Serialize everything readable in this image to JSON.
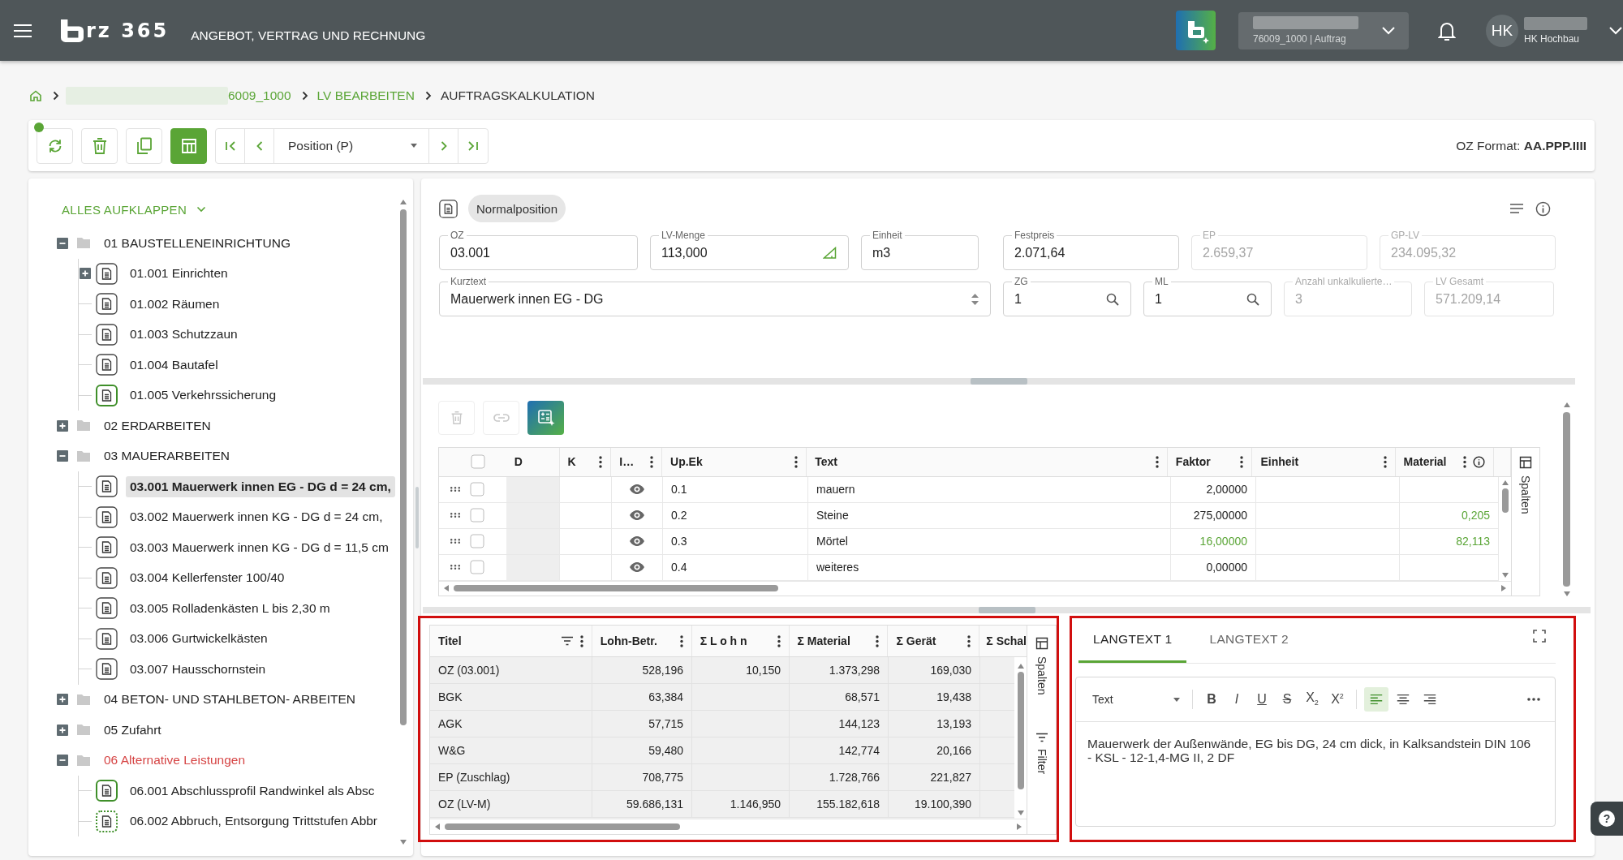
{
  "header": {
    "logo": "rz 365",
    "app_title": "ANGEBOT, VERTRAG UND RECHNUNG",
    "project": {
      "subtitle": "76009_1000 | Auftrag"
    },
    "user": {
      "initials": "HK",
      "company": "HK Hochbau"
    }
  },
  "breadcrumb": [
    {
      "label": "6009_1000",
      "link": true
    },
    {
      "label": "LV BEARBEITEN",
      "link": true
    },
    {
      "label": "AUFTRAGSKALKULATION",
      "link": false
    }
  ],
  "toolbar": {
    "sync_dot": true,
    "buttons": [
      {
        "kind": "refresh",
        "active": false
      },
      {
        "kind": "delete",
        "active": false
      },
      {
        "kind": "copy",
        "active": false
      },
      {
        "kind": "layout",
        "active": true
      }
    ],
    "position_select": "Position (P)",
    "oz_format": "OZ Format: **AA.PPP.IIII**"
  },
  "tree": {
    "expand_all": "ALLES AUFKLAPPEN",
    "items": [
      {
        "label": "01 BAUSTELLENEINRICHTUNG",
        "expanded": true,
        "invalid": false,
        "selected": false,
        "children": [
          {
            "label": "01.001 Einrichten",
            "expanded": false,
            "marked": false,
            "dotted": false,
            "selected": false
          },
          {
            "label": "01.002 Räumen",
            "marked": false,
            "dotted": false,
            "selected": false
          },
          {
            "label": "01.003 Schutzzaun",
            "marked": false,
            "dotted": false,
            "selected": false
          },
          {
            "label": "01.004 Bautafel",
            "marked": false,
            "dotted": false,
            "selected": false
          },
          {
            "label": "01.005 Verkehrssicherung",
            "marked": true,
            "dotted": false,
            "selected": false
          }
        ]
      },
      {
        "label": "02 ERDARBEITEN",
        "expanded": false,
        "invalid": false,
        "selected": false
      },
      {
        "label": "03 MAUERARBEITEN",
        "expanded": true,
        "invalid": false,
        "selected": false,
        "children": [
          {
            "label": "03.001 Mauerwerk innen EG - DG d = 24 cm,",
            "marked": false,
            "dotted": false,
            "selected": true
          },
          {
            "label": "03.002 Mauerwerk innen KG - DG d = 24 cm,",
            "marked": false,
            "dotted": false,
            "selected": false
          },
          {
            "label": "03.003 Mauerwerk innen KG - DG d = 11,5 cm",
            "marked": false,
            "dotted": false,
            "selected": false
          },
          {
            "label": "03.004 Kellerfenster 100/40",
            "marked": false,
            "dotted": false,
            "selected": false
          },
          {
            "label": "03.005 Rolladenkästen L bis 2,30 m",
            "marked": false,
            "dotted": false,
            "selected": false
          },
          {
            "label": "03.006 Gurtwickelkästen",
            "marked": false,
            "dotted": false,
            "selected": false
          },
          {
            "label": "03.007 Hausschornstein",
            "marked": false,
            "dotted": false,
            "selected": false
          }
        ]
      },
      {
        "label": "04 BETON- UND STAHLBETON- ARBEITEN",
        "expanded": false,
        "invalid": false,
        "selected": false
      },
      {
        "label": "05 Zufahrt",
        "expanded": false,
        "invalid": false,
        "selected": false
      },
      {
        "label": "06 Alternative Leistungen",
        "expanded": true,
        "invalid": true,
        "selected": false,
        "children": [
          {
            "label": "06.001 Abschlussprofil Randwinkel als Absc",
            "marked": true,
            "dotted": false,
            "selected": false
          },
          {
            "label": "06.002 Abbruch, Entsorgung Trittstufen Abbr",
            "marked": true,
            "dotted": true,
            "selected": false
          }
        ]
      }
    ]
  },
  "position_form": {
    "type": "Normalposition",
    "rows": [
      {
        "fields": [
          {
            "label": "OZ",
            "value": "03.001",
            "kind": "text",
            "disabled": false
          },
          {
            "label": "LV-Menge",
            "value": "113,000",
            "kind": "quantity",
            "disabled": false
          },
          {
            "label": "Einheit",
            "value": "m3",
            "kind": "text",
            "disabled": false
          },
          {
            "label": "Festpreis",
            "value": "2.071,64",
            "kind": "text",
            "disabled": false
          },
          {
            "label": "EP",
            "value": "2.659,37",
            "kind": "text",
            "disabled": true
          },
          {
            "label": "GP-LV",
            "value": "234.095,32",
            "kind": "text",
            "disabled": true
          }
        ]
      },
      {
        "fields": [
          {
            "label": "Kurztext",
            "value": "Mauerwerk innen EG - DG",
            "kind": "select",
            "disabled": false
          },
          {
            "label": "ZG",
            "value": "1",
            "kind": "lookup",
            "disabled": false
          },
          {
            "label": "ML",
            "value": "1",
            "kind": "lookup",
            "disabled": false
          },
          {
            "label": "Anzahl unkalkulierte…",
            "value": "3",
            "kind": "text",
            "disabled": true
          },
          {
            "label": "LV Gesamt",
            "value": "571.209,14",
            "kind": "text",
            "disabled": true
          }
        ]
      }
    ]
  },
  "items_table": {
    "actions": [
      {
        "kind": "delete",
        "disabled": true
      },
      {
        "kind": "link",
        "disabled": true
      },
      {
        "kind": "assistant",
        "disabled": false
      }
    ],
    "all_checked": false,
    "columns": [
      {
        "label": "D",
        "menu": false,
        "info": false
      },
      {
        "label": "K",
        "menu": true,
        "info": false
      },
      {
        "label": "I…",
        "menu": true,
        "info": false
      },
      {
        "label": "Up.Ek",
        "menu": true,
        "info": false
      },
      {
        "label": "Text",
        "menu": true,
        "info": false
      },
      {
        "label": "Faktor",
        "menu": true,
        "info": false
      },
      {
        "label": "Einheit",
        "menu": true,
        "info": false
      },
      {
        "label": "Material",
        "menu": true,
        "info": true
      }
    ],
    "rows": [
      {
        "checked": false,
        "visible": true,
        "up_ek": "0.1",
        "text": "mauern",
        "faktor": "2,00000",
        "faktor_calculated": false
      },
      {
        "checked": false,
        "visible": true,
        "up_ek": "0.2",
        "text": "Steine",
        "faktor": "275,00000",
        "faktor_calculated": false,
        "material": "0,205"
      },
      {
        "checked": false,
        "visible": true,
        "up_ek": "0.3",
        "text": "Mörtel",
        "faktor": "16,00000",
        "faktor_calculated": true,
        "material": "82,113"
      },
      {
        "checked": false,
        "visible": true,
        "up_ek": "0.4",
        "text": "weiteres",
        "faktor": "0,00000",
        "faktor_calculated": false
      }
    ],
    "side_tab": "Spalten"
  },
  "summary_table": {
    "outlined": true,
    "columns": [
      {
        "label": "Titel",
        "filter": true,
        "menu": true
      },
      {
        "label": "Lohn-Betr.",
        "filter": false,
        "menu": true
      },
      {
        "label": "Σ L o h n",
        "filter": false,
        "menu": true
      },
      {
        "label": "Σ Material",
        "filter": false,
        "menu": true
      },
      {
        "label": "Σ Gerät",
        "filter": false,
        "menu": true
      },
      {
        "label": "Σ Schal",
        "filter": false,
        "menu": false
      }
    ],
    "rows": [
      {
        "title": "OZ (03.001)",
        "lohn_betr": "528,196",
        "lohn": "10,150",
        "material": "1.373,298",
        "geraet": "169,030"
      },
      {
        "title": "BGK",
        "lohn_betr": "63,384",
        "material": "68,571",
        "geraet": "19,438"
      },
      {
        "title": "AGK",
        "lohn_betr": "57,715",
        "material": "144,123",
        "geraet": "13,193"
      },
      {
        "title": "W&G",
        "lohn_betr": "59,480",
        "material": "142,774",
        "geraet": "20,166"
      },
      {
        "title": "EP (Zuschlag)",
        "lohn_betr": "708,775",
        "material": "1.728,766",
        "geraet": "221,827"
      },
      {
        "title": "OZ (LV-M)",
        "lohn_betr": "59.686,131",
        "lohn": "1.146,950",
        "material": "155.182,618",
        "geraet": "19.100,390"
      }
    ],
    "side_tabs": [
      {
        "label": "Spalten",
        "kind": "columns"
      },
      {
        "label": "Filter",
        "kind": "filter"
      }
    ]
  },
  "langtext": {
    "outlined": true,
    "tabs": [
      {
        "label": "LANGTEXT 1",
        "selected": true
      },
      {
        "label": "LANGTEXT 2",
        "selected": false
      }
    ],
    "style_select": "Text",
    "format_buttons": [
      {
        "label": "B",
        "kind": "bold"
      },
      {
        "label": "I",
        "kind": "italic"
      },
      {
        "label": "U",
        "kind": "underline"
      },
      {
        "label": "S",
        "kind": "strike"
      },
      {
        "label": "X$_{2}$",
        "kind": "subscript"
      },
      {
        "label": "X$^{2}$",
        "kind": "superscript"
      }
    ],
    "align_buttons": [
      {
        "kind": "left",
        "selected": true
      },
      {
        "kind": "center",
        "selected": false
      },
      {
        "kind": "right",
        "selected": false
      }
    ],
    "text": "Mauerwerk der Außenwände, EG bis DG, 24 cm dick, in Kalksandstein DIN 106 - KSL - 12-1,4-MG II, 2 DF"
  },
  "help_button": "?"
}
